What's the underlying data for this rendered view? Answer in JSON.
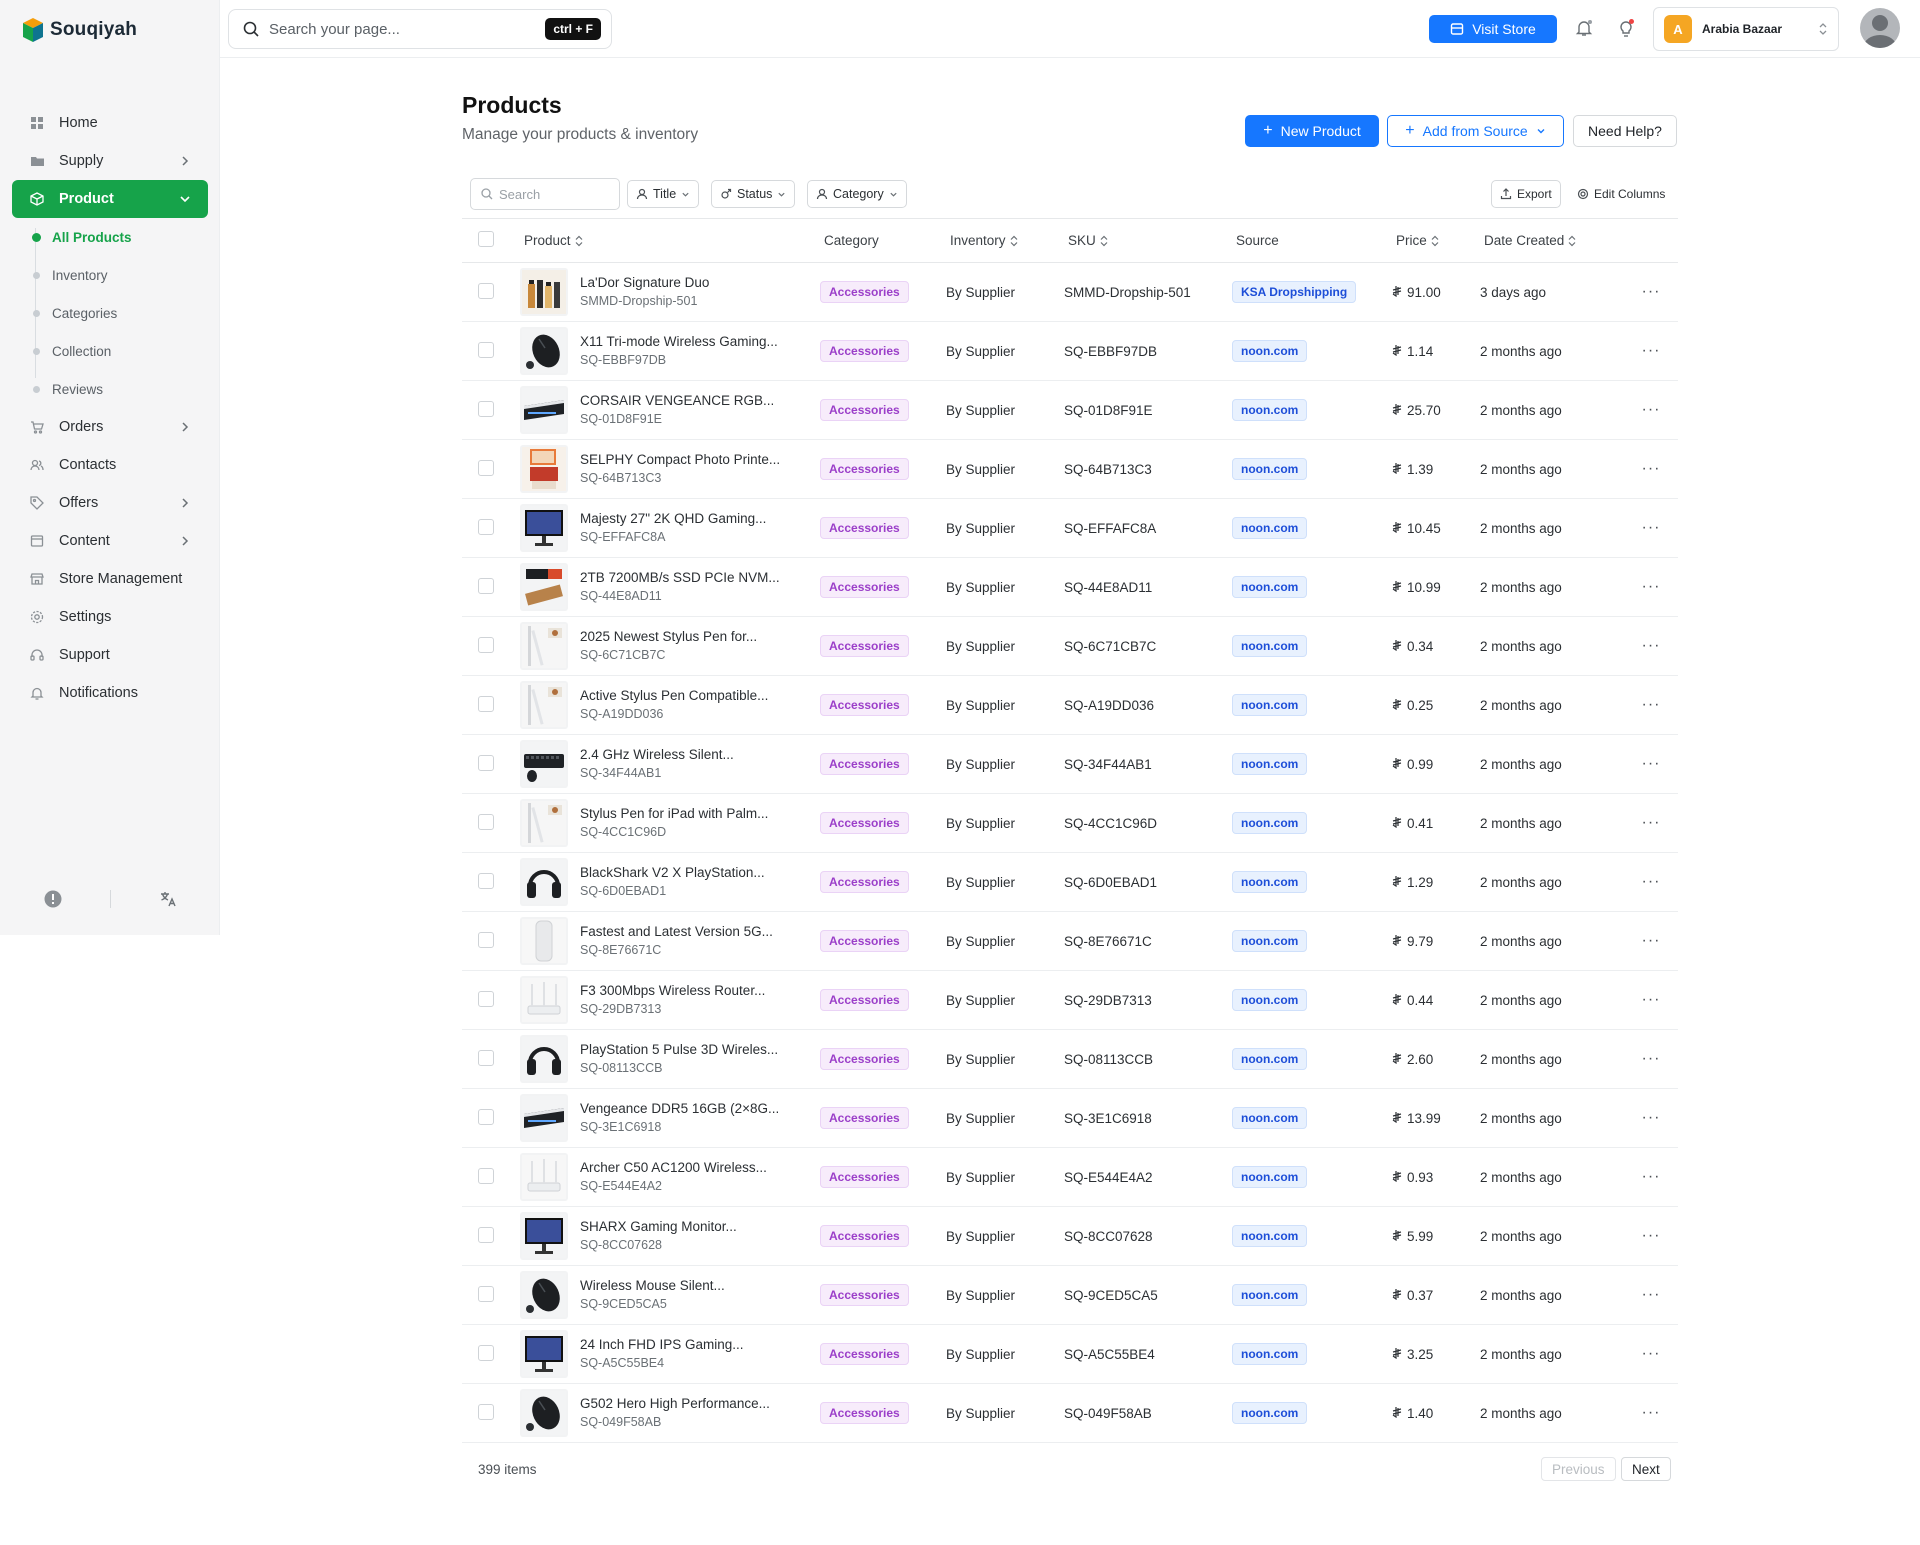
{
  "brand": {
    "name": "Souqiyah"
  },
  "topbar": {
    "search_placeholder": "Search your page...",
    "shortcut": "ctrl + F",
    "visit_store": "Visit Store",
    "store_initial": "A",
    "store_name": "Arabia Bazaar"
  },
  "sidebar": {
    "items": [
      {
        "label": "Home",
        "icon": "grid-icon",
        "chevron": false
      },
      {
        "label": "Supply",
        "icon": "folder-icon",
        "chevron": true
      },
      {
        "label": "Product",
        "icon": "box-icon",
        "chevron": true,
        "active": true
      },
      {
        "label": "Orders",
        "icon": "cart-icon",
        "chevron": true
      },
      {
        "label": "Contacts",
        "icon": "users-icon",
        "chevron": false
      },
      {
        "label": "Offers",
        "icon": "tag-icon",
        "chevron": true
      },
      {
        "label": "Content",
        "icon": "file-icon",
        "chevron": true
      },
      {
        "label": "Store Management",
        "icon": "store-icon",
        "chevron": false
      },
      {
        "label": "Settings",
        "icon": "gear-icon",
        "chevron": false
      },
      {
        "label": "Support",
        "icon": "headset-icon",
        "chevron": false
      },
      {
        "label": "Notifications",
        "icon": "bell-icon",
        "chevron": false
      }
    ],
    "product_sub": [
      "All Products",
      "Inventory",
      "Categories",
      "Collection",
      "Reviews"
    ]
  },
  "page": {
    "title": "Products",
    "subtitle": "Manage your products & inventory",
    "new_product": "New Product",
    "add_from_source": "Add from Source",
    "need_help": "Need Help?"
  },
  "filters": {
    "search_placeholder": "Search",
    "title": "Title",
    "status": "Status",
    "category": "Category",
    "export": "Export",
    "edit_columns": "Edit Columns"
  },
  "table": {
    "headers": [
      "Product",
      "Category",
      "Inventory",
      "SKU",
      "Source",
      "Price",
      "Date Created"
    ],
    "rows": [
      {
        "name": "La'Dor Signature Duo",
        "sku": "SMMD-Dropship-501",
        "category": "Accessories",
        "inventory": "By Supplier",
        "source": "KSA Dropshipping",
        "price": "91.00",
        "date": "3 days ago",
        "thumb": "bottles"
      },
      {
        "name": "X11 Tri-mode Wireless Gaming...",
        "sku": "SQ-EBBF97DB",
        "category": "Accessories",
        "inventory": "By Supplier",
        "source": "noon.com",
        "price": "1.14",
        "date": "2 months ago",
        "thumb": "mouse"
      },
      {
        "name": "CORSAIR VENGEANCE RGB...",
        "sku": "SQ-01D8F91E",
        "category": "Accessories",
        "inventory": "By Supplier",
        "source": "noon.com",
        "price": "25.70",
        "date": "2 months ago",
        "thumb": "ram"
      },
      {
        "name": "SELPHY Compact Photo Printe...",
        "sku": "SQ-64B713C3",
        "category": "Accessories",
        "inventory": "By Supplier",
        "source": "noon.com",
        "price": "1.39",
        "date": "2 months ago",
        "thumb": "printer"
      },
      {
        "name": "Majesty 27\" 2K QHD Gaming...",
        "sku": "SQ-EFFAFC8A",
        "category": "Accessories",
        "inventory": "By Supplier",
        "source": "noon.com",
        "price": "10.45",
        "date": "2 months ago",
        "thumb": "monitor"
      },
      {
        "name": "2TB 7200MB/s SSD PCIe NVM...",
        "sku": "SQ-44E8AD11",
        "category": "Accessories",
        "inventory": "By Supplier",
        "source": "noon.com",
        "price": "10.99",
        "date": "2 months ago",
        "thumb": "ssd"
      },
      {
        "name": "2025 Newest Stylus Pen for...",
        "sku": "SQ-6C71CB7C",
        "category": "Accessories",
        "inventory": "By Supplier",
        "source": "noon.com",
        "price": "0.34",
        "date": "2 months ago",
        "thumb": "pen"
      },
      {
        "name": "Active Stylus Pen Compatible...",
        "sku": "SQ-A19DD036",
        "category": "Accessories",
        "inventory": "By Supplier",
        "source": "noon.com",
        "price": "0.25",
        "date": "2 months ago",
        "thumb": "pen"
      },
      {
        "name": "2.4 GHz Wireless Silent...",
        "sku": "SQ-34F44AB1",
        "category": "Accessories",
        "inventory": "By Supplier",
        "source": "noon.com",
        "price": "0.99",
        "date": "2 months ago",
        "thumb": "keyboard"
      },
      {
        "name": "Stylus Pen for iPad with Palm...",
        "sku": "SQ-4CC1C96D",
        "category": "Accessories",
        "inventory": "By Supplier",
        "source": "noon.com",
        "price": "0.41",
        "date": "2 months ago",
        "thumb": "pen"
      },
      {
        "name": "BlackShark V2 X PlayStation...",
        "sku": "SQ-6D0EBAD1",
        "category": "Accessories",
        "inventory": "By Supplier",
        "source": "noon.com",
        "price": "1.29",
        "date": "2 months ago",
        "thumb": "headset"
      },
      {
        "name": "Fastest and Latest Version 5G...",
        "sku": "SQ-8E76671C",
        "category": "Accessories",
        "inventory": "By Supplier",
        "source": "noon.com",
        "price": "9.79",
        "date": "2 months ago",
        "thumb": "router-tower"
      },
      {
        "name": "F3 300Mbps Wireless Router...",
        "sku": "SQ-29DB7313",
        "category": "Accessories",
        "inventory": "By Supplier",
        "source": "noon.com",
        "price": "0.44",
        "date": "2 months ago",
        "thumb": "router"
      },
      {
        "name": "PlayStation 5 Pulse 3D Wireles...",
        "sku": "SQ-08113CCB",
        "category": "Accessories",
        "inventory": "By Supplier",
        "source": "noon.com",
        "price": "2.60",
        "date": "2 months ago",
        "thumb": "headset"
      },
      {
        "name": "Vengeance DDR5 16GB (2×8G...",
        "sku": "SQ-3E1C6918",
        "category": "Accessories",
        "inventory": "By Supplier",
        "source": "noon.com",
        "price": "13.99",
        "date": "2 months ago",
        "thumb": "ram"
      },
      {
        "name": "Archer C50 AC1200 Wireless...",
        "sku": "SQ-E544E4A2",
        "category": "Accessories",
        "inventory": "By Supplier",
        "source": "noon.com",
        "price": "0.93",
        "date": "2 months ago",
        "thumb": "router"
      },
      {
        "name": "SHARX Gaming Monitor...",
        "sku": "SQ-8CC07628",
        "category": "Accessories",
        "inventory": "By Supplier",
        "source": "noon.com",
        "price": "5.99",
        "date": "2 months ago",
        "thumb": "monitor"
      },
      {
        "name": "Wireless Mouse Silent...",
        "sku": "SQ-9CED5CA5",
        "category": "Accessories",
        "inventory": "By Supplier",
        "source": "noon.com",
        "price": "0.37",
        "date": "2 months ago",
        "thumb": "mouse"
      },
      {
        "name": "24 Inch FHD IPS Gaming...",
        "sku": "SQ-A5C55BE4",
        "category": "Accessories",
        "inventory": "By Supplier",
        "source": "noon.com",
        "price": "3.25",
        "date": "2 months ago",
        "thumb": "monitor"
      },
      {
        "name": "G502 Hero High Performance...",
        "sku": "SQ-049F58AB",
        "category": "Accessories",
        "inventory": "By Supplier",
        "source": "noon.com",
        "price": "1.40",
        "date": "2 months ago",
        "thumb": "mouse"
      }
    ]
  },
  "pagination": {
    "total": "399 items",
    "previous": "Previous",
    "next": "Next"
  },
  "colors": {
    "accent_green": "#16a34a",
    "primary_blue": "#1677ff",
    "category_purple": "#9b3fc9",
    "source_blue": "#1d4ed8"
  }
}
